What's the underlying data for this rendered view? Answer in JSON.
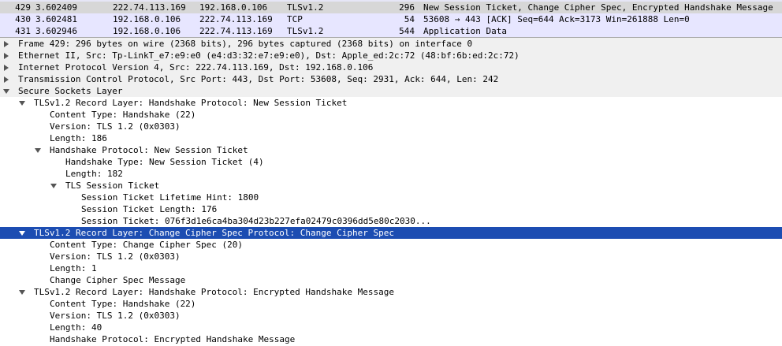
{
  "packet_list": {
    "rows": [
      {
        "no": "429",
        "time": "3.602409",
        "src": "222.74.113.169",
        "dst": "192.168.0.106",
        "proto": "TLSv1.2",
        "len": "296",
        "info": "New Session Ticket, Change Cipher Spec, Encrypted Handshake Message"
      },
      {
        "no": "430",
        "time": "3.602481",
        "src": "192.168.0.106",
        "dst": "222.74.113.169",
        "proto": "TCP",
        "len": "54",
        "info": "53608 → 443 [ACK] Seq=644 Ack=3173 Win=261888 Len=0"
      },
      {
        "no": "431",
        "time": "3.602946",
        "src": "192.168.0.106",
        "dst": "222.74.113.169",
        "proto": "TLSv1.2",
        "len": "544",
        "info": "Application Data"
      }
    ]
  },
  "details": {
    "lines": [
      {
        "text": "Frame 429: 296 bytes on wire (2368 bits), 296 bytes captured (2368 bits) on interface 0",
        "level": 0,
        "toggle": "collapsed"
      },
      {
        "text": "Ethernet II, Src: Tp-LinkT_e7:e9:e0 (e4:d3:32:e7:e9:e0), Dst: Apple_ed:2c:72 (48:bf:6b:ed:2c:72)",
        "level": 0,
        "toggle": "collapsed"
      },
      {
        "text": "Internet Protocol Version 4, Src: 222.74.113.169, Dst: 192.168.0.106",
        "level": 0,
        "toggle": "collapsed"
      },
      {
        "text": "Transmission Control Protocol, Src Port: 443, Dst Port: 53608, Seq: 2931, Ack: 644, Len: 242",
        "level": 0,
        "toggle": "collapsed"
      },
      {
        "text": "Secure Sockets Layer",
        "level": 0,
        "toggle": "expanded"
      },
      {
        "text": "TLSv1.2 Record Layer: Handshake Protocol: New Session Ticket",
        "level": 1,
        "toggle": "expanded"
      },
      {
        "text": "Content Type: Handshake (22)",
        "level": 2,
        "toggle": "none"
      },
      {
        "text": "Version: TLS 1.2 (0x0303)",
        "level": 2,
        "toggle": "none"
      },
      {
        "text": "Length: 186",
        "level": 2,
        "toggle": "none"
      },
      {
        "text": "Handshake Protocol: New Session Ticket",
        "level": 2,
        "toggle": "expanded"
      },
      {
        "text": "Handshake Type: New Session Ticket (4)",
        "level": 3,
        "toggle": "none"
      },
      {
        "text": "Length: 182",
        "level": 3,
        "toggle": "none"
      },
      {
        "text": "TLS Session Ticket",
        "level": 3,
        "toggle": "expanded"
      },
      {
        "text": "Session Ticket Lifetime Hint: 1800",
        "level": 4,
        "toggle": "none"
      },
      {
        "text": "Session Ticket Length: 176",
        "level": 4,
        "toggle": "none"
      },
      {
        "text": "Session Ticket: 076f3d1e6ca4ba304d23b227efa02479c0396dd5e80c2030...",
        "level": 4,
        "toggle": "none"
      },
      {
        "text": "TLSv1.2 Record Layer: Change Cipher Spec Protocol: Change Cipher Spec",
        "level": 1,
        "toggle": "expanded",
        "selected": true
      },
      {
        "text": "Content Type: Change Cipher Spec (20)",
        "level": 2,
        "toggle": "none"
      },
      {
        "text": "Version: TLS 1.2 (0x0303)",
        "level": 2,
        "toggle": "none"
      },
      {
        "text": "Length: 1",
        "level": 2,
        "toggle": "none"
      },
      {
        "text": "Change Cipher Spec Message",
        "level": 2,
        "toggle": "none"
      },
      {
        "text": "TLSv1.2 Record Layer: Handshake Protocol: Encrypted Handshake Message",
        "level": 1,
        "toggle": "expanded"
      },
      {
        "text": "Content Type: Handshake (22)",
        "level": 2,
        "toggle": "none"
      },
      {
        "text": "Version: TLS 1.2 (0x0303)",
        "level": 2,
        "toggle": "none"
      },
      {
        "text": "Length: 40",
        "level": 2,
        "toggle": "none"
      },
      {
        "text": "Handshake Protocol: Encrypted Handshake Message",
        "level": 2,
        "toggle": "none"
      }
    ]
  },
  "colors": {
    "selection": "#1c4db2",
    "row_tint": "#e7e6ff",
    "selected_packet": "#d7d7d7"
  },
  "icons": {
    "collapsed": "triangle-right-icon",
    "expanded": "triangle-down-icon"
  }
}
